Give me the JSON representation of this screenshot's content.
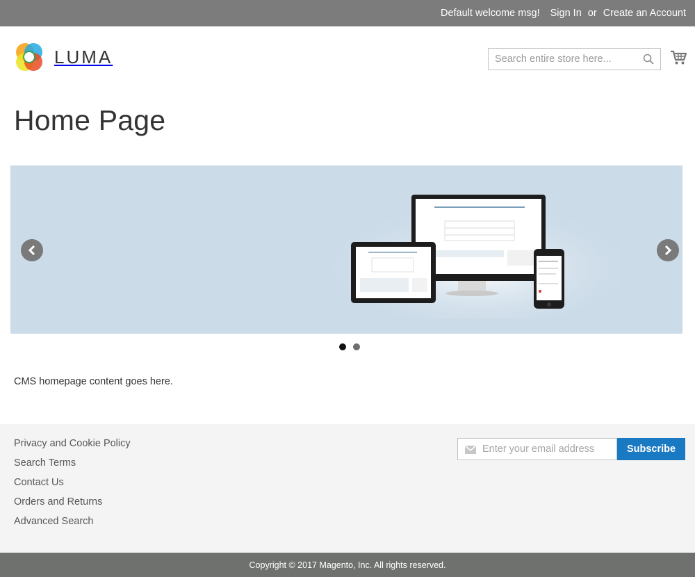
{
  "header": {
    "welcome": "Default welcome msg!",
    "sign_in": "Sign In",
    "or": "or",
    "create_account": "Create an Account",
    "logo_text": "LUMA"
  },
  "search": {
    "placeholder": "Search entire store here..."
  },
  "page": {
    "title": "Home Page",
    "cms_text": "CMS homepage content goes here."
  },
  "slider": {
    "slide_count": 2,
    "active_slide": 1,
    "background": "#cbdbe8"
  },
  "footer": {
    "links": [
      "Privacy and Cookie Policy",
      "Search Terms",
      "Contact Us",
      "Orders and Returns",
      "Advanced Search"
    ],
    "newsletter_placeholder": "Enter your email address",
    "subscribe_label": "Subscribe",
    "copyright": "Copyright © 2017 Magento, Inc. All rights reserved."
  },
  "colors": {
    "topbar": "#7b7c7b",
    "accent": "#1979c3",
    "copyright_bar": "#6e716e"
  },
  "icons": [
    "luma-logo-icon",
    "search-icon",
    "cart-icon",
    "chevron-left-icon",
    "chevron-right-icon",
    "mail-icon"
  ]
}
